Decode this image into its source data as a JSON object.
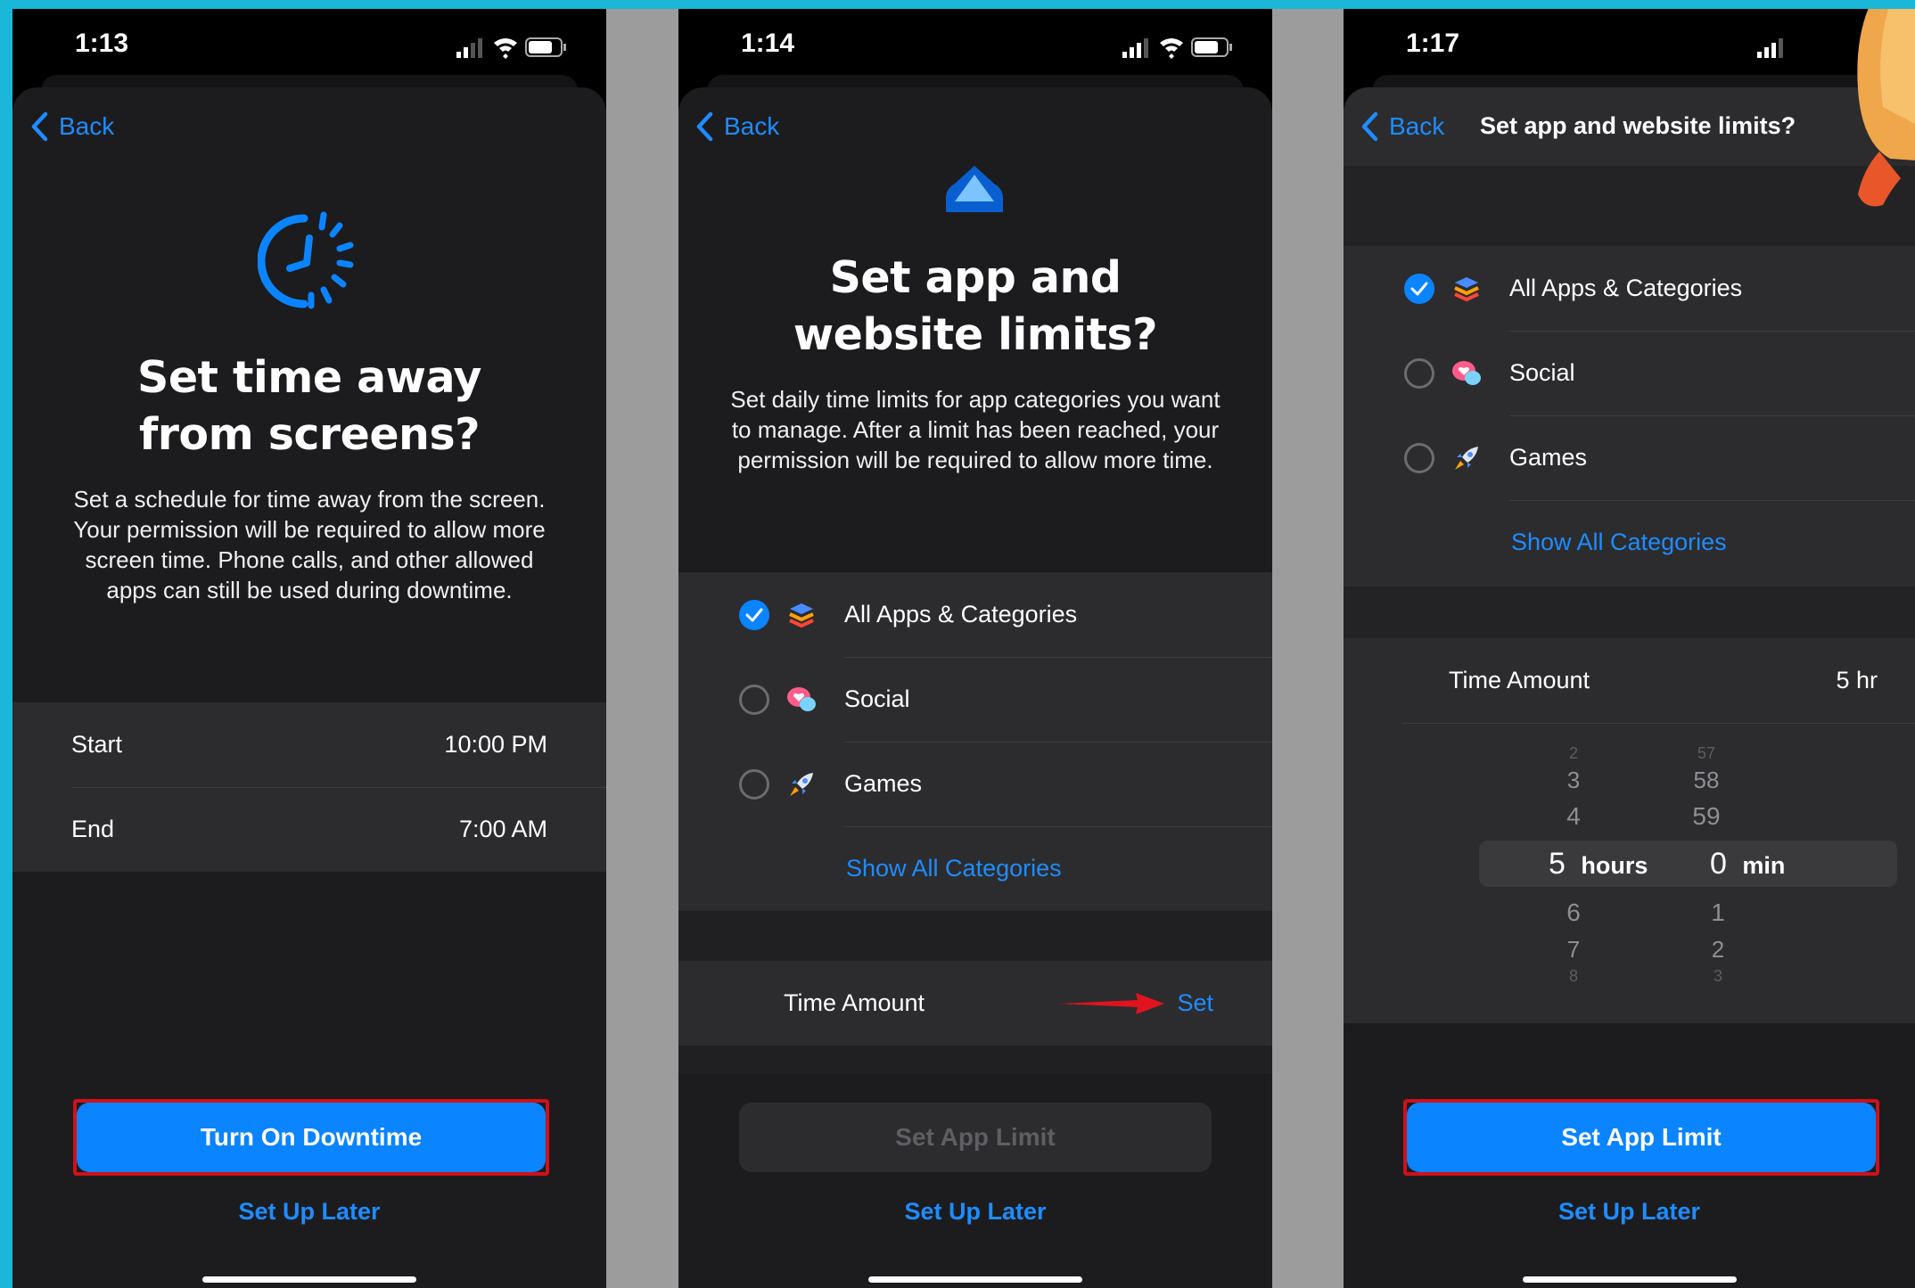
{
  "panels": [
    {
      "status_time": "1:13",
      "back_label": "Back",
      "title_line1": "Set time away",
      "title_line2": "from screens?",
      "description": "Set a schedule for time away from the screen. Your permission will be required to allow more screen time. Phone calls, and other allowed apps can still be used during downtime.",
      "schedule": [
        {
          "label": "Start",
          "value": "10:00 PM"
        },
        {
          "label": "End",
          "value": "7:00 AM"
        }
      ],
      "primary_button": "Turn On Downtime",
      "secondary_link": "Set Up Later"
    },
    {
      "status_time": "1:14",
      "back_label": "Back",
      "title_line1": "Set app and",
      "title_line2": "website limits?",
      "description": "Set daily time limits for app categories you want to manage. After a limit has been reached, your permission will be required to allow more time.",
      "categories": [
        {
          "label": "All Apps & Categories",
          "selected": true
        },
        {
          "label": "Social",
          "selected": false
        },
        {
          "label": "Games",
          "selected": false
        }
      ],
      "show_all": "Show All Categories",
      "time_amount_label": "Time Amount",
      "time_amount_action": "Set",
      "primary_button": "Set App Limit",
      "primary_enabled": false,
      "secondary_link": "Set Up Later"
    },
    {
      "status_time": "1:17",
      "back_label": "Back",
      "nav_title": "Set app and website limits?",
      "categories": [
        {
          "label": "All Apps & Categories",
          "selected": true
        },
        {
          "label": "Social",
          "selected": false
        },
        {
          "label": "Games",
          "selected": false
        }
      ],
      "show_all": "Show All Categories",
      "time_amount_label": "Time Amount",
      "time_amount_value": "5 hr",
      "picker": {
        "hours_above": [
          "2",
          "3",
          "4"
        ],
        "hours_selected": "5",
        "hours_unit": "hours",
        "hours_below": [
          "6",
          "7",
          "8"
        ],
        "mins_above": [
          "57",
          "58",
          "59"
        ],
        "mins_selected": "0",
        "mins_unit": "min",
        "mins_below": [
          "1",
          "2",
          "3"
        ]
      },
      "primary_button": "Set App Limit",
      "secondary_link": "Set Up Later"
    }
  ],
  "colors": {
    "accent": "#0a84ff",
    "highlight_outline": "#d0101a",
    "background": "#1ab7d8"
  }
}
